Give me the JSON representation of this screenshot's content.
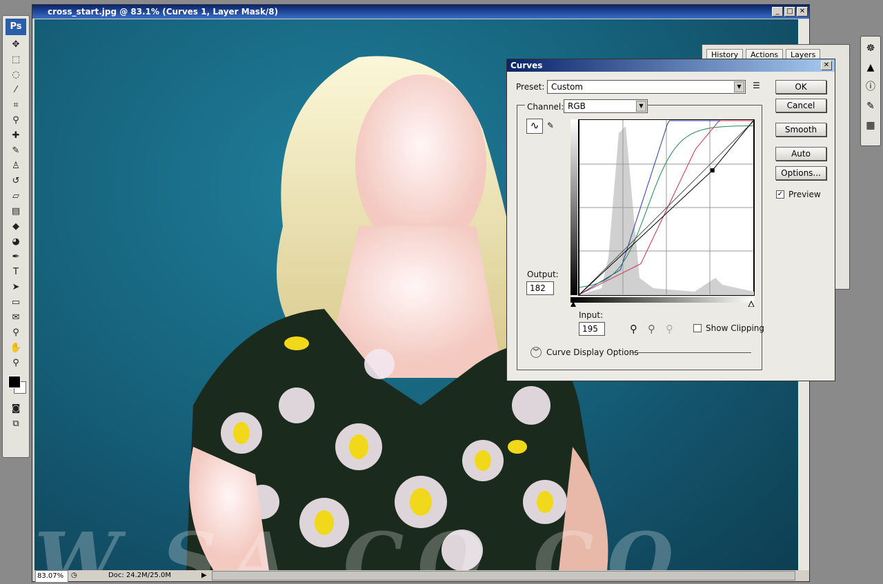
{
  "document": {
    "title": "cross_start.jpg @ 83.1% (Curves 1, Layer Mask/8)",
    "zoom": "83.07%",
    "doc_size": "Doc: 24.2M/25.0M",
    "watermark": "W.SA   CO.CO"
  },
  "toolbox": {
    "logo": "Ps",
    "tools": [
      "move-icon",
      "marquee-icon",
      "lasso-icon",
      "magic-wand-icon",
      "crop-icon",
      "eyedropper-icon",
      "healing-brush-icon",
      "brush-icon",
      "clone-stamp-icon",
      "history-brush-icon",
      "eraser-icon",
      "gradient-icon",
      "blur-icon",
      "dodge-icon",
      "pen-icon",
      "type-icon",
      "path-select-icon",
      "shape-icon",
      "notes-icon",
      "eyedropper-icon",
      "hand-icon",
      "zoom-icon"
    ]
  },
  "panels": {
    "tabs": [
      "History",
      "Actions",
      "Layers"
    ]
  },
  "curves": {
    "title": "Curves",
    "preset_label": "Preset:",
    "preset_value": "Custom",
    "channel_label": "Channel:",
    "channel_value": "RGB",
    "buttons": {
      "ok": "OK",
      "cancel": "Cancel",
      "smooth": "Smooth",
      "auto": "Auto",
      "options": "Options..."
    },
    "preview_label": "Preview",
    "preview_checked": true,
    "output_label": "Output:",
    "output_value": "182",
    "input_label": "Input:",
    "input_value": "195",
    "show_clipping_label": "Show Clipping",
    "show_clipping_checked": false,
    "display_options_label": "Curve Display Options",
    "colors": {
      "red": "#d0304a",
      "green": "#1e8a4a",
      "blue": "#2a3aa0",
      "rgb": "#000000"
    }
  }
}
